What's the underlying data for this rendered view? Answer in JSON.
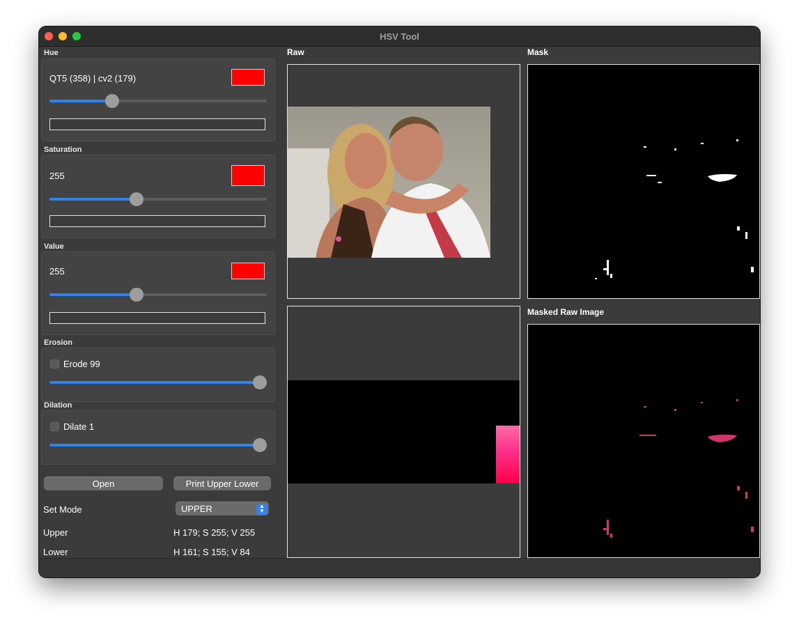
{
  "window": {
    "title": "HSV Tool"
  },
  "groups": {
    "hue": {
      "label": "Hue",
      "value_text": "QT5 (358) | cv2 (179)",
      "swatch_color": "#ff0000",
      "slider_fraction": 0.29,
      "text": ""
    },
    "saturation": {
      "label": "Saturation",
      "value_text": "255",
      "swatch_color": "#ff0000",
      "slider_fraction": 0.4,
      "text": ""
    },
    "value": {
      "label": "Value",
      "value_text": "255",
      "swatch_color": "#ff0000",
      "slider_fraction": 0.4,
      "text": ""
    },
    "erosion": {
      "label": "Erosion",
      "checkbox_label": "Erode 99",
      "checked": false,
      "slider_fraction": 1.0
    },
    "dilation": {
      "label": "Dilation",
      "checkbox_label": "Dilate 1",
      "checked": false,
      "slider_fraction": 1.0
    }
  },
  "buttons": {
    "open": "Open",
    "print": "Print Upper Lower"
  },
  "mode": {
    "label": "Set Mode",
    "selected": "UPPER"
  },
  "bounds": {
    "upper_label": "Upper",
    "upper_value": "H 179; S 255; V 255",
    "lower_label": "Lower",
    "lower_value": "H 161; S 155; V 84"
  },
  "panels": {
    "raw": "Raw",
    "mask": "Mask",
    "masked_raw": "Masked Raw Image"
  },
  "colors": {
    "accent": "#2f83ea",
    "window_bg": "#3b3b3b",
    "swatch": "#ff0000",
    "highlight_pink": "#ff3c8c"
  }
}
